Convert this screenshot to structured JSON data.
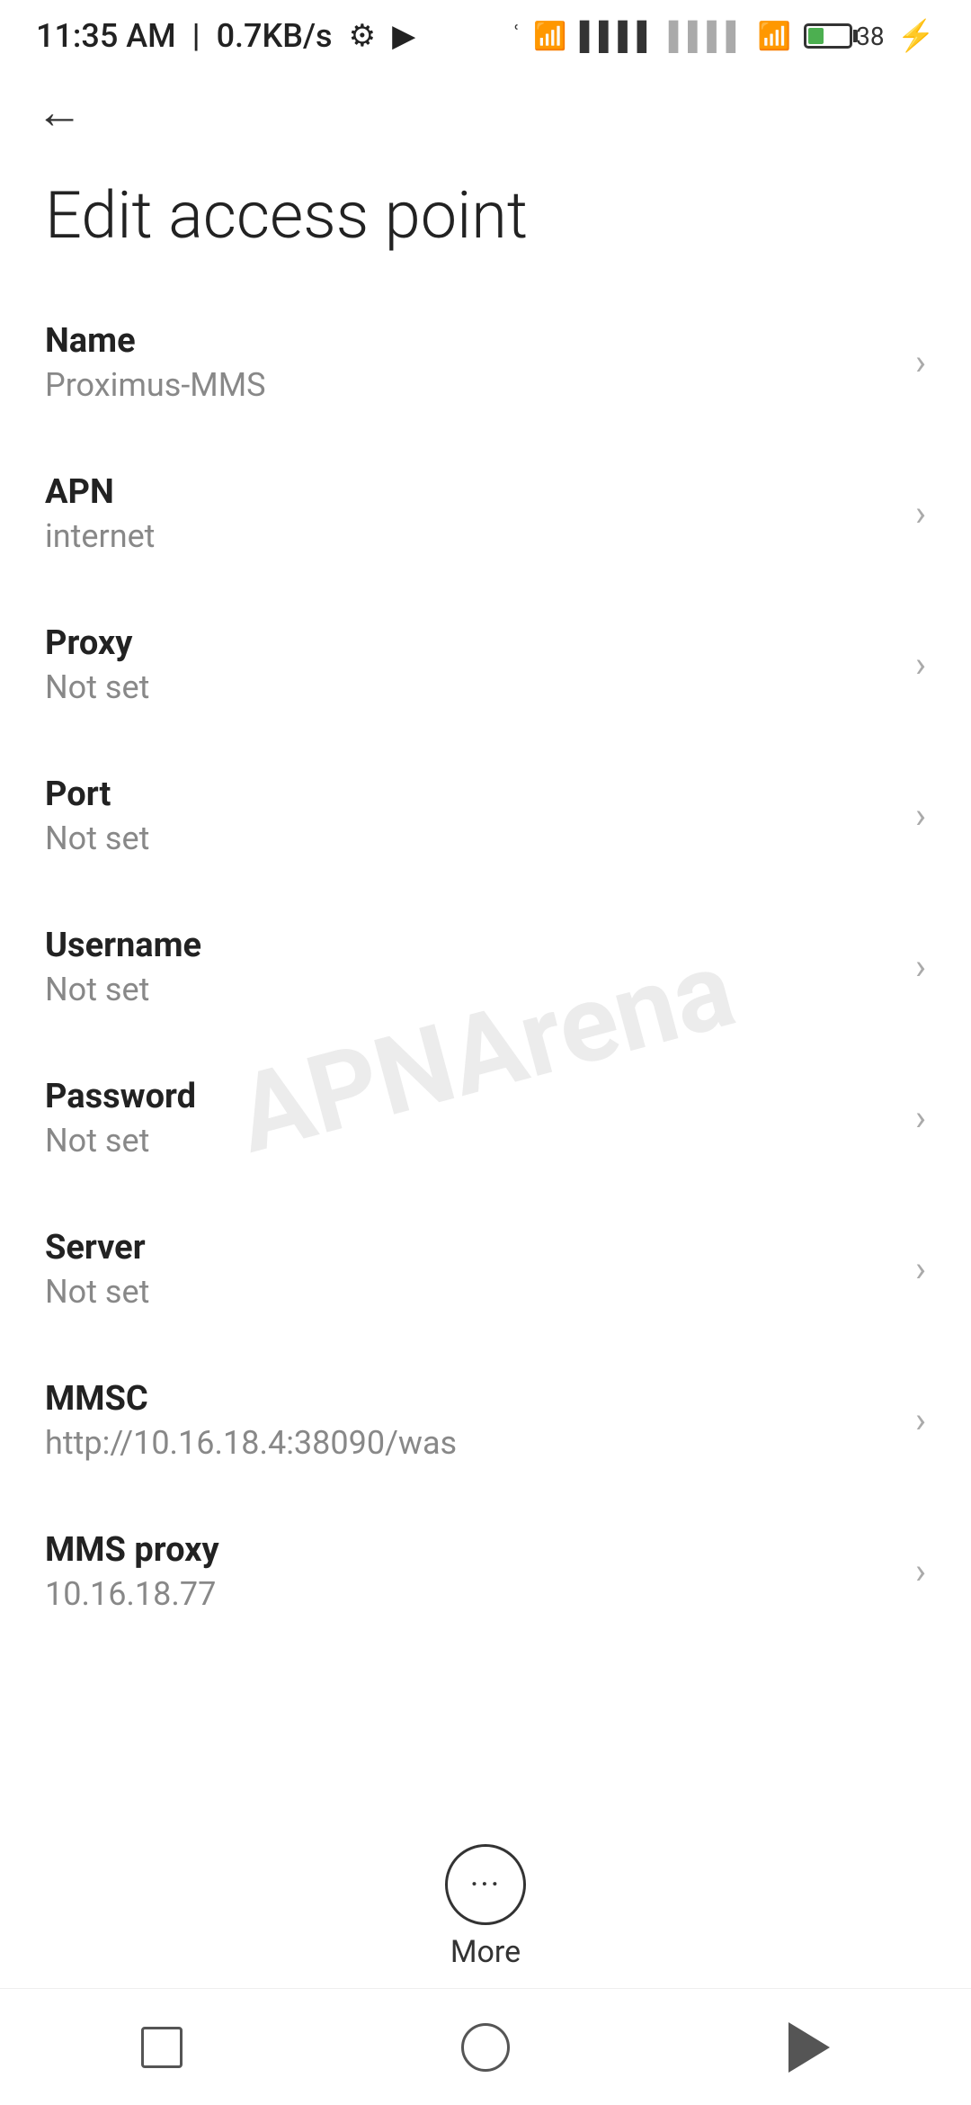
{
  "status": {
    "time": "11:35 AM",
    "speed": "0.7KB/s"
  },
  "nav": {
    "back_label": "←"
  },
  "page": {
    "title": "Edit access point"
  },
  "settings": [
    {
      "label": "Name",
      "value": "Proximus-MMS"
    },
    {
      "label": "APN",
      "value": "internet"
    },
    {
      "label": "Proxy",
      "value": "Not set"
    },
    {
      "label": "Port",
      "value": "Not set"
    },
    {
      "label": "Username",
      "value": "Not set"
    },
    {
      "label": "Password",
      "value": "Not set"
    },
    {
      "label": "Server",
      "value": "Not set"
    },
    {
      "label": "MMSC",
      "value": "http://10.16.18.4:38090/was"
    },
    {
      "label": "MMS proxy",
      "value": "10.16.18.77"
    }
  ],
  "more": {
    "label": "More"
  },
  "watermark": "APNArena"
}
